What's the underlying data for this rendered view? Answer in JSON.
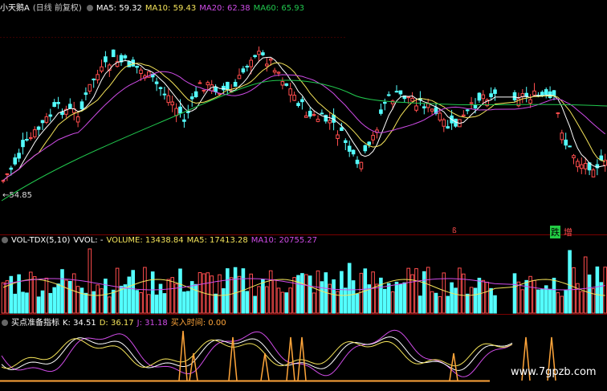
{
  "colors": {
    "bg": "#000000",
    "up": "#ff4d4d",
    "down": "#54ffff",
    "ma5": "#ffffff",
    "ma10": "#f5e45a",
    "ma20": "#d04ce8",
    "ma60": "#21c84e",
    "grid": "#7a0000",
    "k": "#ffffff",
    "d": "#f5e45a",
    "j": "#d04ce8",
    "signal": "#ffa53a"
  },
  "main_panel": {
    "stock_name": "小天鹅A",
    "period": "(日线 前复权)",
    "ma5": "MA5: 59.32",
    "ma10": "MA10: 59.43",
    "ma20": "MA20: 62.38",
    "ma60": "MA60: 65.93",
    "low_marker": "←54.85",
    "signal_text_1": "跌",
    "signal_text_2": "增",
    "signal_mark": "ß"
  },
  "volume_panel": {
    "name": "VOL-TDX(5,10)",
    "vvol": "VVOL: -",
    "volume": "VOLUME: 13438.84",
    "ma5": "MA5: 17413.28",
    "ma10": "MA10: 20755.27"
  },
  "indicator_panel": {
    "name": "买点准备指标",
    "k": "K: 34.51",
    "d": "D: 36.17",
    "j": "J: 31.18",
    "buy_time": "买入时间: 0.00"
  },
  "watermark": "www.7gpzb.com"
}
